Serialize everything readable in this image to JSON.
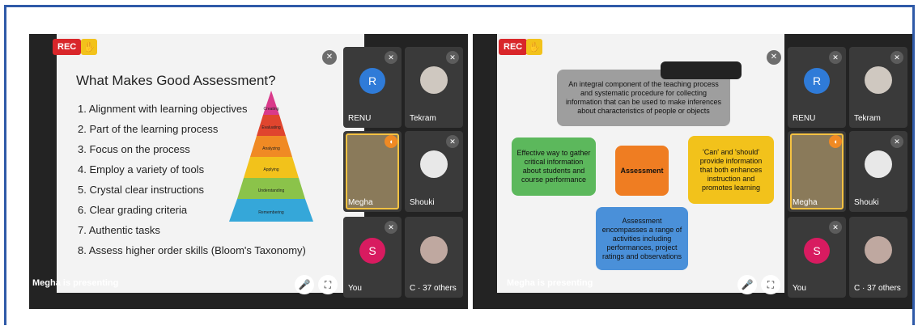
{
  "left_call": {
    "rec_label": "REC",
    "slide_title": "What Makes Good Assessment?",
    "list_items": [
      "1. Alignment with learning objectives",
      "2. Part of the learning process",
      "3. Focus on the process",
      "4. Employ a variety of tools",
      "5. Crystal clear instructions",
      "6. Clear grading criteria",
      "7. Authentic tasks",
      "8. Assess higher order skills (Bloom's Taxonomy)"
    ],
    "pyramid_levels": [
      "Creating",
      "Evaluating",
      "Analyzing",
      "Applying",
      "Understanding",
      "Remembering"
    ],
    "presenting_label": "Megha is presenting",
    "participants": [
      {
        "name": "RENU",
        "initial": "R",
        "color": "#2f7bd8"
      },
      {
        "name": "Tekram",
        "initial": "",
        "color": "#6b5a4a"
      },
      {
        "name": "Megha",
        "initial": "",
        "color": "#8a7a5a"
      },
      {
        "name": "Shouki",
        "initial": "",
        "color": "#d8d8d8"
      },
      {
        "name": "You",
        "initial": "S",
        "color": "#d81b60"
      },
      {
        "name": "C · 37 others",
        "initial": "",
        "color": "#bfa8a0"
      }
    ]
  },
  "right_call": {
    "rec_label": "REC",
    "box_top": "An integral component of the teaching process and systematic procedure for collecting information that can be used to make inferences about characteristics of people or objects",
    "box_left": "Effective way to gather critical information about students and course performance",
    "box_center": "Assessment",
    "box_right": "'Can' and 'should' provide information that both enhances instruction and promotes learning",
    "box_bottom": "Assessment encompasses a range of activities including performances, project ratings and observations",
    "presenting_label": "Megha is presenting",
    "participants": [
      {
        "name": "RENU",
        "initial": "R",
        "color": "#2f7bd8"
      },
      {
        "name": "Tekram",
        "initial": "",
        "color": "#6b5a4a"
      },
      {
        "name": "Megha",
        "initial": "",
        "color": "#8a7a5a"
      },
      {
        "name": "Shouki",
        "initial": "",
        "color": "#d8d8d8"
      },
      {
        "name": "You",
        "initial": "S",
        "color": "#d81b60"
      },
      {
        "name": "C · 37 others",
        "initial": "",
        "color": "#bfa8a0"
      }
    ]
  }
}
